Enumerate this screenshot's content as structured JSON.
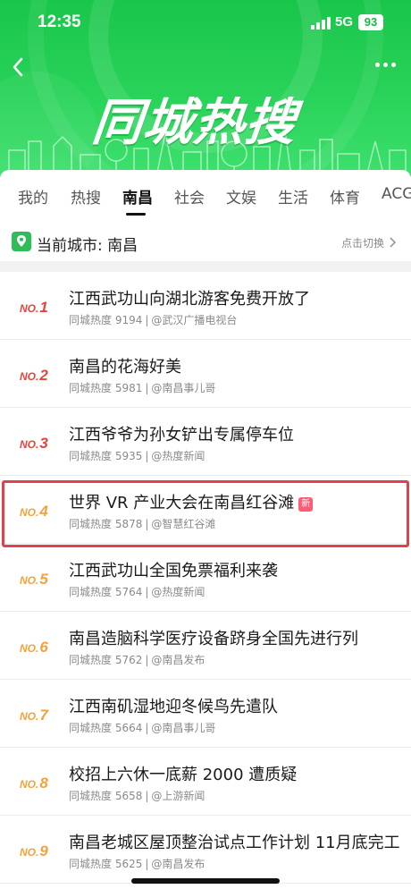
{
  "status": {
    "time": "12:35",
    "network": "5G",
    "battery": "93"
  },
  "header": {
    "title": "同城热搜"
  },
  "tabs": [
    "我的",
    "热搜",
    "南昌",
    "社会",
    "文娱",
    "生活",
    "体育",
    "ACG"
  ],
  "active_tab": "南昌",
  "city": {
    "label": "当前城市: 南昌",
    "switch": "点击切换"
  },
  "colors": {
    "accent": "#19c64a",
    "rank_top": "#e5443b",
    "rank_other": "#f5a13a",
    "highlight": "#e0414b",
    "new_badge": "#ff5a76"
  },
  "list": [
    {
      "no": "NO.",
      "rank": "1",
      "title": "江西武功山向湖北游客免费开放了",
      "heat": "同城热度 9194",
      "source": "@武汉广播电视台"
    },
    {
      "no": "NO.",
      "rank": "2",
      "title": "南昌的花海好美",
      "heat": "同城热度 5981",
      "source": "@南昌事儿哥"
    },
    {
      "no": "NO.",
      "rank": "3",
      "title": "江西爷爷为孙女铲出专属停车位",
      "heat": "同城热度 5935",
      "source": "@热度新闻"
    },
    {
      "no": "NO.",
      "rank": "4",
      "title": "世界 VR 产业大会在南昌红谷滩",
      "badge": "新",
      "heat": "同城热度 5878",
      "source": "@智慧红谷滩"
    },
    {
      "no": "NO.",
      "rank": "5",
      "title": "江西武功山全国免票福利来袭",
      "heat": "同城热度 5764",
      "source": "@热度新闻"
    },
    {
      "no": "NO.",
      "rank": "6",
      "title": "南昌造脑科学医疗设备跻身全国先进行列",
      "heat": "同城热度 5762",
      "source": "@南昌发布"
    },
    {
      "no": "NO.",
      "rank": "7",
      "title": "江西南矶湿地迎冬候鸟先遣队",
      "heat": "同城热度 5664",
      "source": "@南昌事儿哥"
    },
    {
      "no": "NO.",
      "rank": "8",
      "title": "校招上六休一底薪 2000 遭质疑",
      "heat": "同城热度 5658",
      "source": "@上游新闻"
    },
    {
      "no": "NO.",
      "rank": "9",
      "title": "南昌老城区屋顶整治试点工作计划 11月底完工",
      "heat": "同城热度 5625",
      "source": "@南昌发布"
    }
  ]
}
